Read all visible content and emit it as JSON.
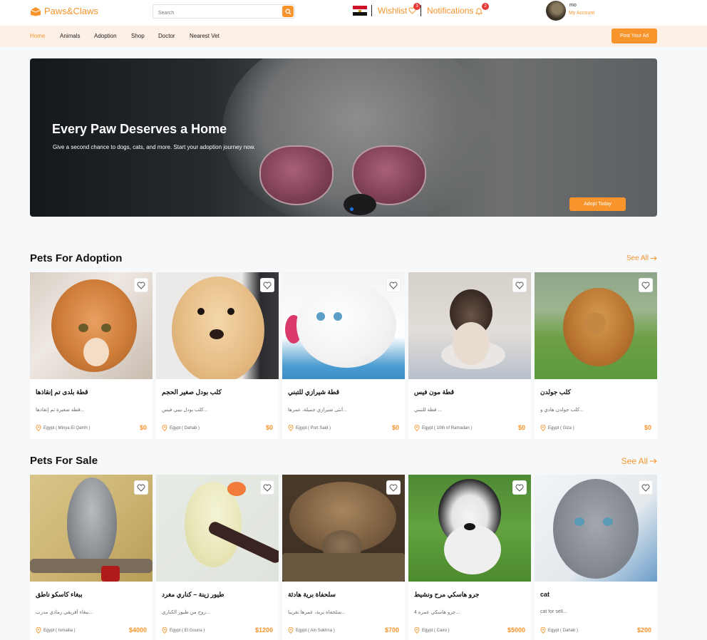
{
  "brand": {
    "name": "Paws&Claws"
  },
  "search": {
    "placeholder": "Search"
  },
  "header": {
    "wishlist_label": "Wishlist",
    "wishlist_count": "3",
    "notifications_label": "Notifications",
    "notifications_count": "2",
    "user_name": "mo",
    "account_label": "My Account"
  },
  "nav": {
    "items": [
      {
        "label": "Home"
      },
      {
        "label": "Animals"
      },
      {
        "label": "Adoption"
      },
      {
        "label": "Shop"
      },
      {
        "label": "Doctor"
      },
      {
        "label": "Nearest Vet"
      }
    ],
    "post_ad_label": "Post Your Ad"
  },
  "hero": {
    "title": "Every Paw Deserves a Home",
    "subtitle": "Give a second chance to dogs, cats, and more. Start your adoption journey now.",
    "cta_label": "Adopt Today"
  },
  "adoption": {
    "title": "Pets For Adoption",
    "see_all": "See All",
    "cards": [
      {
        "name": "قطة بلدى تم إنقاذها",
        "desc": "قطة صغيرة تم إنقاذها...",
        "location": "Egypt ( Minya El Qamh )",
        "price": "$0"
      },
      {
        "name": "كلب بودل صغير الحجم",
        "desc": "كلب بودل بيبي فيس...",
        "location": "Egypt ( Dahab )",
        "price": "$0"
      },
      {
        "name": "قطة شيرازي للتبني",
        "desc": "أنثى شيرازي جميلة، عمرها...",
        "location": "Egypt ( Port Said )",
        "price": "$0"
      },
      {
        "name": "قطة مون فيس",
        "desc": "قطة للتبني ...",
        "location": "Egypt ( 10th of Ramadan )",
        "price": "$0"
      },
      {
        "name": "كلب جولدن",
        "desc": "كلب جولدن هادي و...",
        "location": "Egypt ( Giza )",
        "price": "$0"
      }
    ]
  },
  "sale": {
    "title": "Pets For Sale",
    "see_all": "See All",
    "cards": [
      {
        "name": "ببغاء كاسكو ناطق",
        "desc": "ببغاء أفريقي رمادي مدرب...",
        "location": "Egypt ( Ismailia )",
        "price": "$4000"
      },
      {
        "name": "طيور زينة – كناري مغرد",
        "desc": "زوج من طيور الكناري...",
        "location": "Egypt ( El Gouna )",
        "price": "$1200"
      },
      {
        "name": "سلحفاة برية هادئة",
        "desc": "سلحفاة برية، عمرها تقريبا...",
        "location": "Egypt ( Ain Sukhna )",
        "price": "$700"
      },
      {
        "name": "جرو هاسكي مرح ونشيط",
        "desc": "جرو هاسكي عمره 4...",
        "location": "Egypt ( Cairo )",
        "price": "$5000"
      },
      {
        "name": "cat",
        "desc": "cat for sell...",
        "location": "Egypt ( Dahab )",
        "price": "$200"
      }
    ]
  },
  "colors": {
    "accent": "#f7942c",
    "nav_bg": "#fdf0e6",
    "badge": "#e53935"
  }
}
